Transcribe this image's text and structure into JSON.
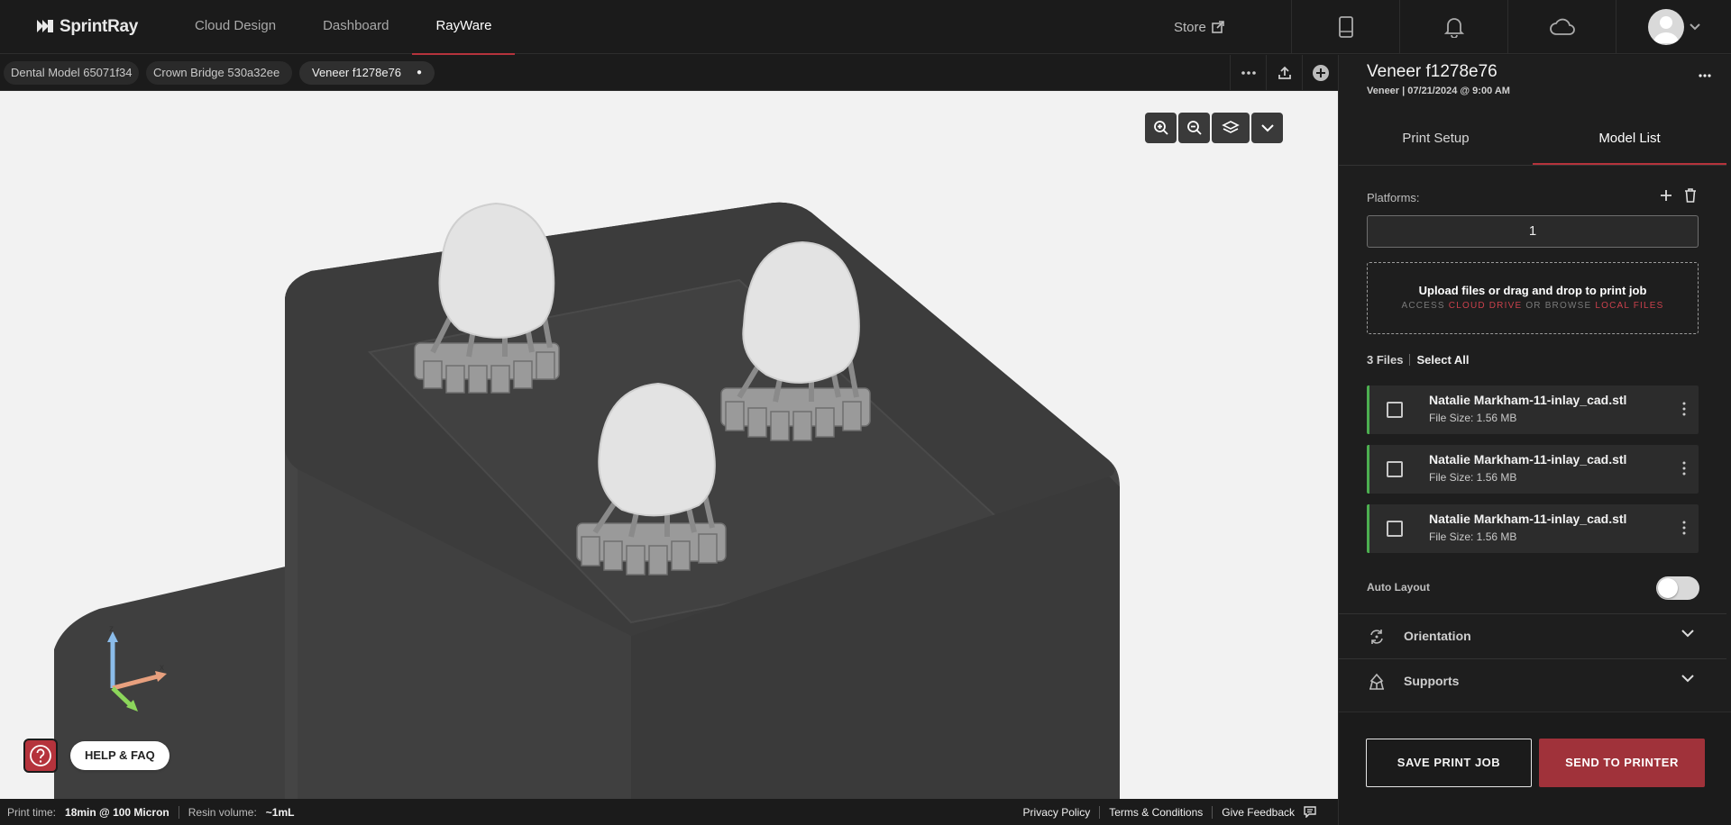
{
  "app": {
    "brand": "SprintRay",
    "nav": [
      {
        "label": "Cloud Design"
      },
      {
        "label": "Dashboard"
      },
      {
        "label": "RayWare"
      }
    ],
    "store_label": "Store",
    "accent": "#b5333c"
  },
  "tabs": [
    {
      "label": "Dental Model 65071f34"
    },
    {
      "label": "Crown Bridge 530a32ee"
    },
    {
      "label": "Veneer f1278e76"
    }
  ],
  "panel": {
    "title": "Veneer f1278e76",
    "subtitle": "Veneer | 07/21/2024 @ 9:00 AM",
    "tabs": [
      {
        "label": "Print Setup"
      },
      {
        "label": "Model List"
      }
    ],
    "platforms_label": "Platforms:",
    "platforms_value": "1",
    "upload_title": "Upload files or drag and drop to print job",
    "upload_access": "ACCESS",
    "upload_cloud": "CLOUD DRIVE",
    "upload_or": "OR BROWSE",
    "upload_local": "LOCAL FILES",
    "files_count": "3 Files",
    "select_all": "Select All",
    "files": [
      {
        "name": "Natalie Markham-11-inlay_cad.stl",
        "size": "File Size: 1.56 MB"
      },
      {
        "name": "Natalie Markham-11-inlay_cad.stl",
        "size": "File Size: 1.56 MB"
      },
      {
        "name": "Natalie Markham-11-inlay_cad.stl",
        "size": "File Size: 1.56 MB"
      }
    ],
    "auto_layout_label": "Auto Layout",
    "auto_layout_on": false,
    "sections": [
      {
        "label": "Orientation",
        "icon": "rotate-icon"
      },
      {
        "label": "Supports",
        "icon": "supports-icon"
      }
    ],
    "save_label": "SAVE PRINT JOB",
    "send_label": "SEND TO PRINTER"
  },
  "viewport": {
    "help_label": "HELP & FAQ",
    "axes": {
      "z": "z",
      "x": "x"
    }
  },
  "status": {
    "print_time_label": "Print time:",
    "print_time_value": "18min @ 100 Micron",
    "resin_label": "Resin volume:",
    "resin_value": "~1mL",
    "links": [
      "Privacy Policy",
      "Terms & Conditions",
      "Give Feedback"
    ]
  }
}
